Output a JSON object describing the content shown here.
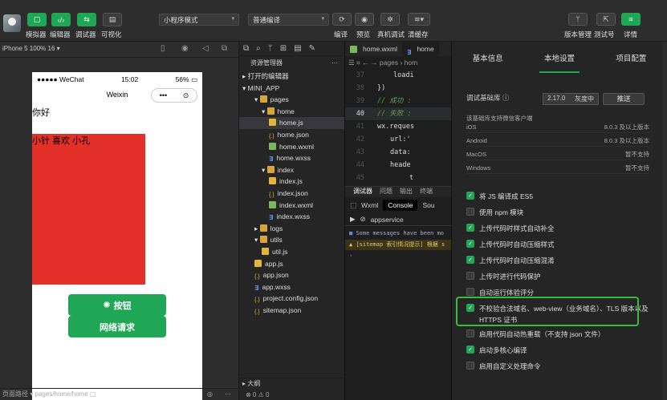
{
  "toolbar": {
    "simulator": "模拟器",
    "editor": "编辑器",
    "debugger": "调试器",
    "visual": "可视化",
    "mode_select": "小程序模式",
    "compile_select": "普通编译",
    "compile": "编译",
    "preview": "预览",
    "real_debug": "真机调试",
    "clear_cache": "清缓存",
    "version_mgmt": "版本管理",
    "test_id": "测试号",
    "details": "详情"
  },
  "simulator": {
    "device": "iPhone 5 100% 16 ▾",
    "status_carrier": "●●●●● WeChat",
    "status_time": "15:02",
    "status_battery": "56%",
    "nav_title": "Weixin",
    "hello": "你好",
    "red_text": "小针 喜欢 小孔",
    "button1": "按钮",
    "button2": "网络请求",
    "page_path_label": "页面路径 ▾",
    "page_path": "pages/home/home"
  },
  "explorer": {
    "title": "资源管理器",
    "open_editors": "打开的编辑器",
    "project": "MINI_APP",
    "items": [
      {
        "label": "pages",
        "type": "folder",
        "indent": 1,
        "arrow": "▾"
      },
      {
        "label": "home",
        "type": "folder",
        "indent": 2,
        "arrow": "▾"
      },
      {
        "label": "home.js",
        "type": "js",
        "indent": 3,
        "selected": true
      },
      {
        "label": "home.json",
        "type": "json",
        "indent": 3
      },
      {
        "label": "home.wxml",
        "type": "wxml",
        "indent": 3
      },
      {
        "label": "home.wxss",
        "type": "wxss",
        "indent": 3
      },
      {
        "label": "index",
        "type": "folder",
        "indent": 2,
        "arrow": "▾"
      },
      {
        "label": "index.js",
        "type": "js",
        "indent": 3
      },
      {
        "label": "index.json",
        "type": "json",
        "indent": 3
      },
      {
        "label": "index.wxml",
        "type": "wxml",
        "indent": 3
      },
      {
        "label": "index.wxss",
        "type": "wxss",
        "indent": 3
      },
      {
        "label": "logs",
        "type": "folder",
        "indent": 1,
        "arrow": "▸"
      },
      {
        "label": "utils",
        "type": "folder",
        "indent": 1,
        "arrow": "▾"
      },
      {
        "label": "util.js",
        "type": "js",
        "indent": 2
      },
      {
        "label": "app.js",
        "type": "js",
        "indent": 1
      },
      {
        "label": "app.json",
        "type": "json",
        "indent": 1
      },
      {
        "label": "app.wxss",
        "type": "wxss",
        "indent": 1
      },
      {
        "label": "project.config.json",
        "type": "json",
        "indent": 1
      },
      {
        "label": "sitemap.json",
        "type": "json",
        "indent": 1
      }
    ],
    "outline": "大纲",
    "problems": "⊗ 0 ⚠ 0"
  },
  "editor": {
    "tab1": "home.wxml",
    "tab2": "home",
    "crumb": "pages › hom",
    "lines": [
      {
        "n": "37",
        "code": "loadi"
      },
      {
        "n": "38",
        "code": "})"
      },
      {
        "n": "39",
        "code": "// 成功 :",
        "cmt": true
      },
      {
        "n": "40",
        "code": "// 失败 :",
        "cmt": true,
        "cur": true
      },
      {
        "n": "41",
        "code": "wx.reques"
      },
      {
        "n": "42",
        "code": "url:'"
      },
      {
        "n": "43",
        "code": "data:"
      },
      {
        "n": "44",
        "code": "heade"
      },
      {
        "n": "45",
        "code": "t"
      }
    ],
    "dbg_tabs": [
      "调试器",
      "问题",
      "输出",
      "终端"
    ],
    "wxml_tab": "Wxml",
    "console_tab": "Console",
    "sources_tab": "Sou",
    "context": "appservice",
    "msg1": "Some messages have been mo",
    "msg2": "[sitemap 索引情况提示] 根据 s"
  },
  "details": {
    "tabs": [
      "基本信息",
      "本地设置",
      "项目配置"
    ],
    "lib_label": "调试基础库",
    "lib_version": "2.17.0",
    "lib_gray": "灰度中",
    "push": "推送",
    "support_head": "该基础库支持微信客户端",
    "support": [
      {
        "os": "iOS",
        "ver": "8.0.3 及以上版本"
      },
      {
        "os": "Android",
        "ver": "8.0.3 及以上版本"
      },
      {
        "os": "MacOS",
        "ver": "暂不支持"
      },
      {
        "os": "Windows",
        "ver": "暂不支持"
      }
    ],
    "options": [
      {
        "label": "将 JS 编译成 ES5",
        "checked": true
      },
      {
        "label": "使用 npm 模块",
        "checked": false
      },
      {
        "label": "上传代码时样式自动补全",
        "checked": true
      },
      {
        "label": "上传代码时自动压缩样式",
        "checked": true
      },
      {
        "label": "上传代码时自动压缩混淆",
        "checked": true
      },
      {
        "label": "上传时进行代码保护",
        "checked": false
      },
      {
        "label": "自动运行体验评分",
        "checked": false
      },
      {
        "label": "不校验合法域名、web-view（业务域名）、TLS 版本以及 HTTPS 证书",
        "checked": true
      },
      {
        "label": "启用代码自动热重载（不支持 json 文件）",
        "checked": false
      },
      {
        "label": "启动多核心编译",
        "checked": true
      },
      {
        "label": "启用自定义处理命令",
        "checked": false
      }
    ]
  }
}
